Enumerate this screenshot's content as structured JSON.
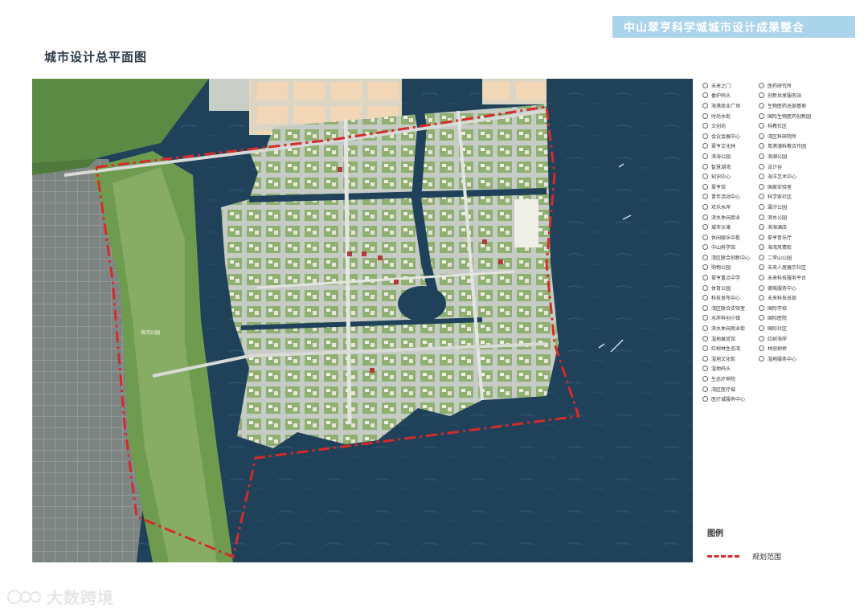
{
  "header": {
    "banner_title": "中山翠亨科学城城市设计成果整合",
    "page_title": "城市设计总平面图"
  },
  "map": {
    "labels": {
      "park": "滨河公园"
    }
  },
  "legend_left": [
    "未来之门",
    "香炉码头",
    "海港商业广场",
    "时尚水街",
    "文创坊",
    "会议会展中心",
    "翠亨文化林",
    "滨海公园",
    "智慧湖湾",
    "知识中心",
    "翠亨馆",
    "青年活动中心",
    "欢乐水岸",
    "滨水休闲商业",
    "城市沙滩",
    "休闲娱乐中枢",
    "中山科学馆",
    "湾区联合创新中心",
    "购物公园",
    "翠亨重点中学",
    "体育公园",
    "科技发布中心",
    "湾区联合实验室",
    "水岸科创小镇",
    "滨水休闲商业街",
    "湿地展览馆",
    "红树林生态湾",
    "湿地文化街",
    "湿地码头",
    "生态疗养院",
    "湾区医疗城",
    "医疗城服务中心"
  ],
  "legend_right": [
    "医药研究所",
    "创新共享服务站",
    "生物医药总部基地",
    "国际生物医药创新园",
    "科教社区",
    "湾区科研院所",
    "粤港澳科教合作园",
    "滨湖公园",
    "设计谷",
    "海洋艺术中心",
    "国家实验室",
    "科学家社区",
    "瀛汐公园",
    "滨水公园",
    "滨海酒店",
    "翠亨音乐厅",
    "海湾风情街",
    "二李山公园",
    "未来人居展示社区",
    "未来科技服务平台",
    "德瑶服务中心",
    "未来科技总部",
    "国际学校",
    "国际医院",
    "国际社区",
    "红树海岸",
    "林冠树桥",
    "湿地服务中心"
  ],
  "legend_box": {
    "title": "图例",
    "boundary_label": "规划范围",
    "boundary_color": "#d52b2b"
  },
  "watermark": {
    "text": "大数跨境"
  },
  "colors": {
    "water": "#1e3f55",
    "land": "#6e9a4a",
    "urban": "#7a8280",
    "banner": "#a9d4ea"
  }
}
